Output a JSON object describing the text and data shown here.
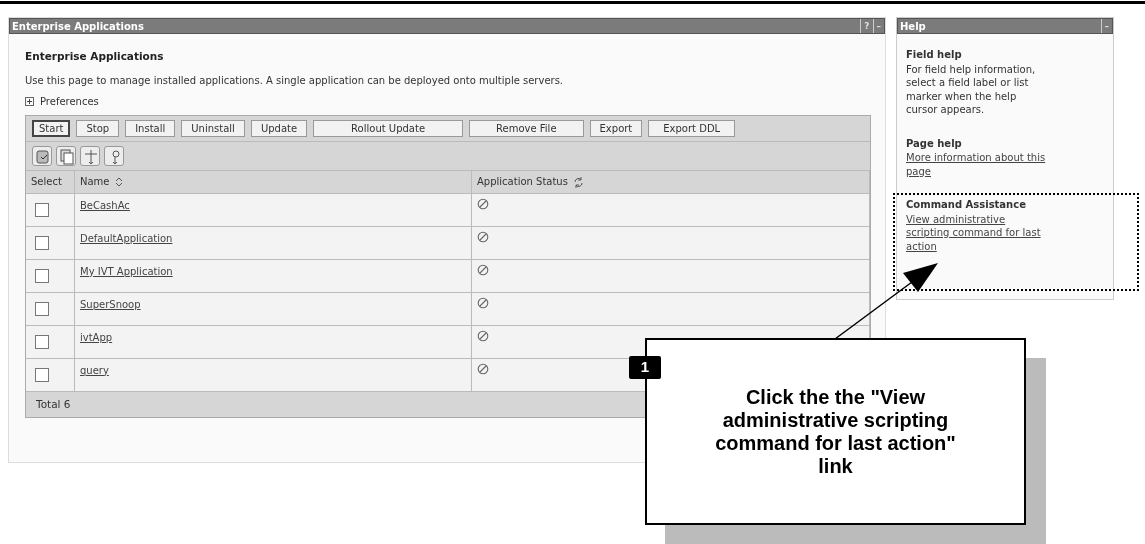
{
  "main_panel": {
    "title": "Enterprise Applications",
    "title_buttons": [
      "?",
      "–"
    ],
    "heading": "Enterprise Applications",
    "description": "Use this page to manage installed applications. A single application can be deployed onto multiple servers.",
    "preferences": {
      "label": "Preferences",
      "expanded": false
    },
    "buttons": [
      {
        "label": "Start",
        "focused": true
      },
      {
        "label": "Stop",
        "focused": false
      },
      {
        "label": "Install",
        "focused": false
      },
      {
        "label": "Uninstall",
        "focused": false
      },
      {
        "label": "Update",
        "focused": false
      },
      {
        "label": "Rollout Update",
        "focused": false
      },
      {
        "label": "Remove File",
        "focused": false
      },
      {
        "label": "Export",
        "focused": false
      },
      {
        "label": "Export DDL",
        "focused": false
      }
    ],
    "table": {
      "columns": [
        "Select",
        "Name",
        "Application Status"
      ],
      "rows": [
        {
          "name": "BeCashAc",
          "checked": false,
          "stopped": true
        },
        {
          "name": "DefaultApplication",
          "checked": false,
          "stopped": true
        },
        {
          "name": "My IVT Application",
          "checked": false,
          "stopped": true
        },
        {
          "name": "SuperSnoop",
          "checked": false,
          "stopped": true
        },
        {
          "name": "ivtApp",
          "checked": false,
          "stopped": true
        },
        {
          "name": "query",
          "checked": false,
          "stopped": true
        }
      ],
      "total": "Total 6"
    }
  },
  "help_panel": {
    "title": "Help",
    "title_button": "–",
    "sections": [
      {
        "heading": "Field help",
        "text": "For field help information, select a field label or list marker when the help cursor appears."
      },
      {
        "heading": "Page help",
        "link": "More information about this page"
      },
      {
        "heading": "Command Assistance",
        "link": "View administrative scripting command for last action"
      }
    ]
  },
  "callout": {
    "number": "1",
    "text": "Click the the \"View administrative scripting command for last action\" link"
  }
}
